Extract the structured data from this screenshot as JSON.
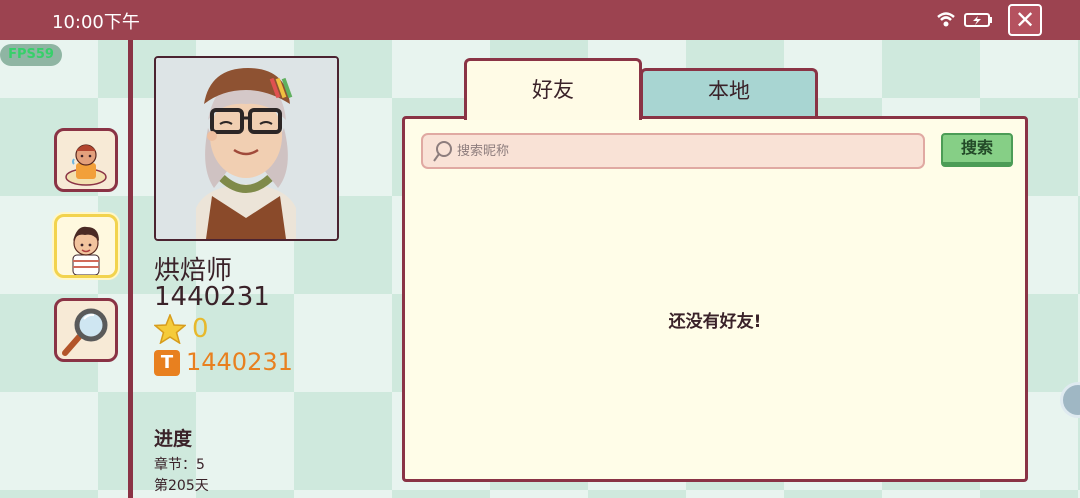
{
  "status_bar": {
    "time": "10:00下午"
  },
  "fps": "FPS59",
  "player": {
    "name": "烘焙师",
    "id": "1440231",
    "stars": "0",
    "hammer_count": "1440231"
  },
  "progress": {
    "title": "进度",
    "chapter": "章节：5",
    "day": "第205天"
  },
  "tabs": [
    {
      "label": "好友",
      "active": true
    },
    {
      "label": "本地",
      "active": false
    }
  ],
  "search": {
    "placeholder": "搜索昵称",
    "value": "",
    "button_label": "搜索"
  },
  "empty_message": "还没有好友!",
  "colors": {
    "topbar": "#9c4350",
    "frame": "#8a3345",
    "panel": "#fffde8",
    "tab_inactive": "#a8d5d2",
    "star": "#e7b92c",
    "hammer": "#e8801f",
    "search_button": "#86cf86"
  },
  "icons": [
    "wifi-icon",
    "battery-icon",
    "close-icon",
    "search-icon",
    "star-icon",
    "hammer-icon",
    "magnifier-icon"
  ]
}
